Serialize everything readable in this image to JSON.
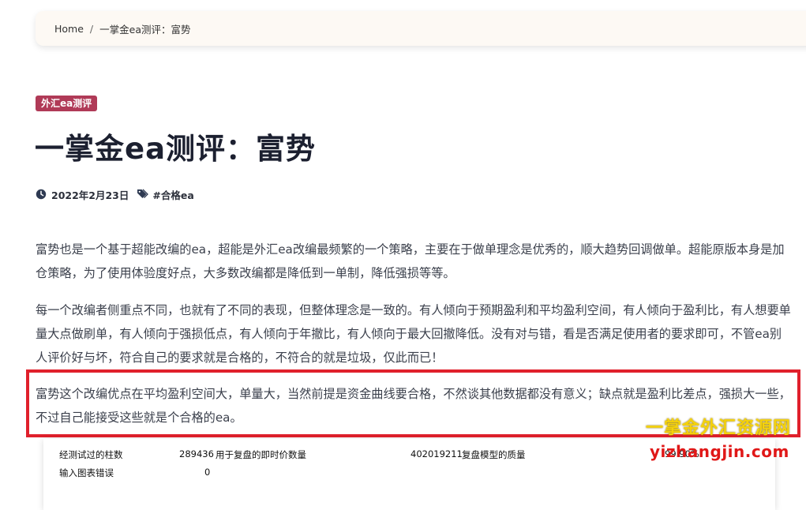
{
  "breadcrumb": {
    "home": "Home",
    "separator": "/",
    "current": "一掌金ea测评：富势"
  },
  "post": {
    "category": "外汇ea测评",
    "title": "一掌金ea测评：富势",
    "date": "2022年2月23日",
    "tag": "#合格ea",
    "paragraphs": [
      "富势也是一个基于超能改编的ea，超能是外汇ea改编最频繁的一个策略，主要在于做单理念是优秀的，顺大趋势回调做单。超能原版本身是加仓策略，为了使用体验度好点，大多数改编都是降低到一单制，降低强损等等。",
      "每一个改编者侧重点不同，也就有了不同的表现，但整体理念是一致的。有人倾向于预期盈利和平均盈利空间，有人倾向于盈利比，有人想要单量大点做刷单，有人倾向于强损低点，有人倾向于年撤比，有人倾向于最大回撤降低。没有对与错，看是否满足使用者的要求即可，不管ea别人评价好与坏，符合自己的要求就是合格的，不符合的就是垃圾，仅此而已！",
      "富势这个改编优点在平均盈利空间大，单量大，当然前提是资金曲线要合格，不然谈其他数据都没有意义；缺点就是盈利比差点，强损大一些，不过自己能接受这些就是个合格的ea。"
    ]
  },
  "watermark": {
    "name": "一掌金外汇资源网",
    "url": "yizhangjin.com"
  },
  "report": {
    "row1": {
      "label_bars": "经测试过的柱数",
      "value_bars": "289436",
      "label_ticks": "用于复盘的即时价数量",
      "value_ticks": "402019211",
      "label_quality": "复盘模型的质量",
      "value_quality": "99.90%"
    },
    "row2": {
      "label_errors": "输入图表错误",
      "value_errors": "0"
    }
  },
  "colors": {
    "badge": "#b03a57",
    "highlight": "#e0202c",
    "watermark_cn": "#f5d20b",
    "watermark_url": "#e01818"
  }
}
